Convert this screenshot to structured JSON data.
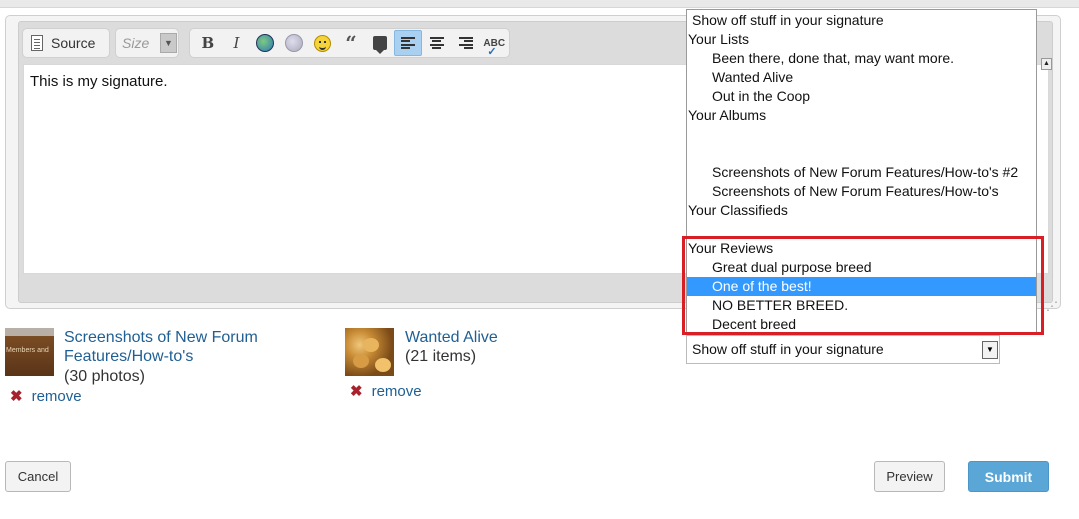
{
  "editor": {
    "toolbar": {
      "source_label": "Source",
      "size_label": "Size"
    },
    "content_text": "This is my signature."
  },
  "dropdown": {
    "header": "Show off stuff in your signature",
    "items": [
      {
        "label": "Your Lists",
        "type": "group"
      },
      {
        "label": "Been there, done that, may want more.",
        "type": "option"
      },
      {
        "label": "Wanted Alive",
        "type": "option"
      },
      {
        "label": "Out in the Coop",
        "type": "option"
      },
      {
        "label": "Your Albums",
        "type": "group"
      },
      {
        "label": "Screenshots of New Forum Features/How-to's #2",
        "type": "option"
      },
      {
        "label": "Screenshots of New Forum Features/How-to's",
        "type": "option"
      },
      {
        "label": "Your Classifieds",
        "type": "group"
      },
      {
        "label": "Your Reviews",
        "type": "group"
      },
      {
        "label": "Great dual purpose breed",
        "type": "option"
      },
      {
        "label": "One of the best!",
        "type": "option",
        "selected": true
      },
      {
        "label": "NO BETTER BREED.",
        "type": "option"
      },
      {
        "label": "Decent breed",
        "type": "option"
      }
    ],
    "selected_value": "Show off stuff in your signature",
    "highlight_color": "#d91f26",
    "selection_color": "#3399ff"
  },
  "attachments": [
    {
      "title_line1": "Screenshots of New Forum",
      "title_line2": "Features/How-to's",
      "count": "(30 photos)",
      "thumb_text": "Members and",
      "remove_label": "remove"
    },
    {
      "title_line1": "Wanted Alive",
      "count": "(21 items)",
      "remove_label": "remove"
    }
  ],
  "buttons": {
    "cancel": "Cancel",
    "preview": "Preview",
    "submit": "Submit"
  }
}
